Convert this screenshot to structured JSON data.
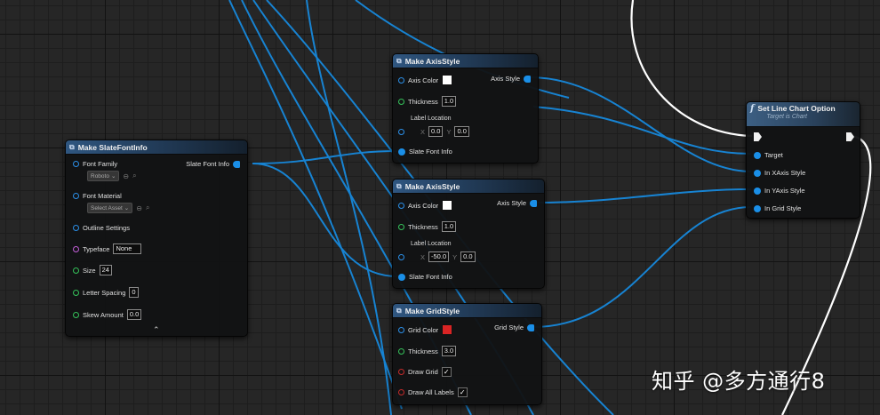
{
  "font_node": {
    "title": "Make SlateFontInfo",
    "font_family_label": "Font Family",
    "font_family_value": "Roboto",
    "font_material_label": "Font Material",
    "font_material_value": "Select Asset",
    "outline_label": "Outline Settings",
    "typeface_label": "Typeface",
    "typeface_value": "None",
    "size_label": "Size",
    "size_value": "24",
    "letter_spacing_label": "Letter Spacing",
    "letter_spacing_value": "0",
    "skew_label": "Skew Amount",
    "skew_value": "0.0",
    "output_label": "Slate Font Info",
    "collapse_glyph": "⌃"
  },
  "axis_node_1": {
    "title": "Make AxisStyle",
    "axis_color_label": "Axis Color",
    "thickness_label": "Thickness",
    "thickness_value": "1.0",
    "label_location_label": "Label Location",
    "x_label": "X",
    "x_value": "0.0",
    "y_label": "Y",
    "y_value": "0.0",
    "font_label": "Slate Font Info",
    "output_label": "Axis Style"
  },
  "axis_node_2": {
    "title": "Make AxisStyle",
    "axis_color_label": "Axis Color",
    "thickness_label": "Thickness",
    "thickness_value": "1.0",
    "label_location_label": "Label Location",
    "x_label": "X",
    "x_value": "-50.0",
    "y_label": "Y",
    "y_value": "0.0",
    "font_label": "Slate Font Info",
    "output_label": "Axis Style"
  },
  "grid_node": {
    "title": "Make GridStyle",
    "grid_color_label": "Grid Color",
    "thickness_label": "Thickness",
    "thickness_value": "3.0",
    "draw_grid_label": "Draw Grid",
    "draw_all_labels_label": "Draw All Labels",
    "output_label": "Grid Style",
    "check_glyph": "✓"
  },
  "set_node": {
    "func_glyph": "f",
    "title": "Set Line Chart Option",
    "subtitle": "Target is Chart",
    "target_label": "Target",
    "x_axis_label": "In XAxis Style",
    "y_axis_label": "In YAxis Style",
    "grid_label": "In Grid Style"
  },
  "colors": {
    "wire_struct": "#1a8fe8",
    "wire_exec": "#ffffff",
    "axis_color": "#ffffff",
    "grid_color": "#d92424"
  },
  "watermark": "知乎 @多方通行8"
}
